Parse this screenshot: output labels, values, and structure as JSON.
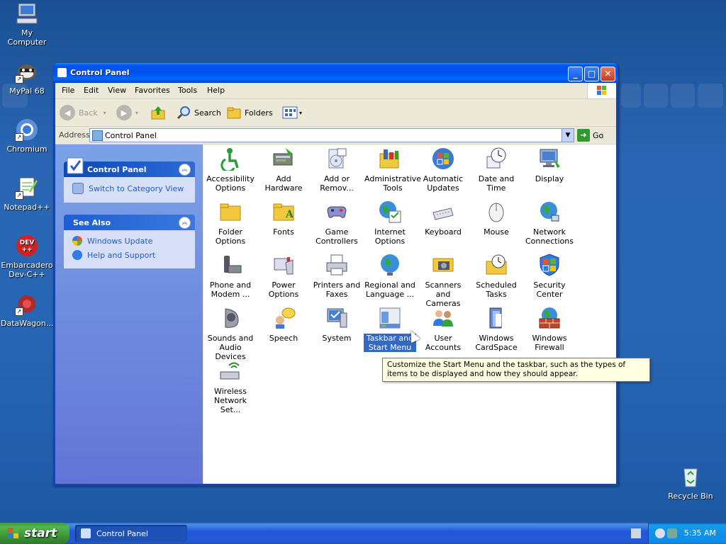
{
  "desktop": {
    "icons": [
      {
        "label": "My Computer"
      },
      {
        "label": "MyPal 68"
      },
      {
        "label": "Chromium"
      },
      {
        "label": "Notepad++"
      },
      {
        "label": "Embarcadero Dev-C++"
      },
      {
        "label": "DataWagon..."
      },
      {
        "label": "Recycle Bin"
      }
    ]
  },
  "window": {
    "title": "Control Panel",
    "buttons": {
      "minimize": "_",
      "maximize": "□",
      "close": "✕"
    },
    "menu": [
      "File",
      "Edit",
      "View",
      "Favorites",
      "Tools",
      "Help"
    ],
    "toolbar": {
      "back": "Back",
      "search": "Search",
      "folders": "Folders"
    },
    "address": {
      "label": "Address",
      "value": "Control Panel",
      "go": "Go"
    },
    "leftpane": {
      "control_panel": {
        "title": "Control Panel",
        "links": [
          "Switch to Category View"
        ]
      },
      "see_also": {
        "title": "See Also",
        "links": [
          "Windows Update",
          "Help and Support"
        ]
      }
    },
    "items": [
      {
        "name": "Accessibility Options",
        "icon": "accessibility-icon"
      },
      {
        "name": "Add Hardware",
        "icon": "add-hardware-icon"
      },
      {
        "name": "Add or Remov...",
        "icon": "add-remove-icon"
      },
      {
        "name": "Administrative Tools",
        "icon": "admin-tools-icon"
      },
      {
        "name": "Automatic Updates",
        "icon": "windows-update-icon"
      },
      {
        "name": "Date and Time",
        "icon": "clock-icon"
      },
      {
        "name": "Display",
        "icon": "display-icon"
      },
      {
        "name": "Folder Options",
        "icon": "folder-icon"
      },
      {
        "name": "Fonts",
        "icon": "fonts-folder-icon"
      },
      {
        "name": "Game Controllers",
        "icon": "gamepad-icon"
      },
      {
        "name": "Internet Options",
        "icon": "internet-icon"
      },
      {
        "name": "Keyboard",
        "icon": "keyboard-icon"
      },
      {
        "name": "Mouse",
        "icon": "mouse-icon"
      },
      {
        "name": "Network Connections",
        "icon": "network-icon"
      },
      {
        "name": "Phone and Modem ...",
        "icon": "phone-icon"
      },
      {
        "name": "Power Options",
        "icon": "power-icon"
      },
      {
        "name": "Printers and Faxes",
        "icon": "printer-icon"
      },
      {
        "name": "Regional and Language ...",
        "icon": "globe-icon"
      },
      {
        "name": "Scanners and Cameras",
        "icon": "scanner-icon"
      },
      {
        "name": "Scheduled Tasks",
        "icon": "scheduled-tasks-icon"
      },
      {
        "name": "Security Center",
        "icon": "shield-icon"
      },
      {
        "name": "Sounds and Audio Devices",
        "icon": "speaker-icon"
      },
      {
        "name": "Speech",
        "icon": "speech-icon"
      },
      {
        "name": "System",
        "icon": "system-icon"
      },
      {
        "name": "Taskbar and Start Menu",
        "icon": "taskbar-icon"
      },
      {
        "name": "User Accounts",
        "icon": "users-icon"
      },
      {
        "name": "Windows CardSpace",
        "icon": "cardspace-icon"
      },
      {
        "name": "Windows Firewall",
        "icon": "firewall-icon"
      },
      {
        "name": "Wireless Network Set...",
        "icon": "wireless-icon"
      }
    ],
    "selected_item": "Taskbar and Start Menu",
    "tooltip": "Customize the Start Menu and the taskbar, such as the types of items to be displayed and how they should appear."
  },
  "taskbar": {
    "start": "start",
    "task": "Control Panel",
    "clock": "5:35 AM"
  }
}
